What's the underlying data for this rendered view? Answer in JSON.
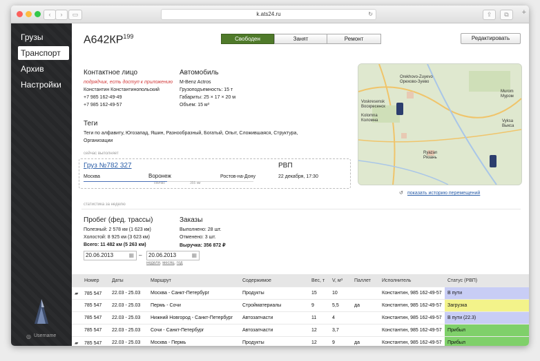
{
  "browser": {
    "url": "k.ats24.ru"
  },
  "sidebar": {
    "items": [
      {
        "label": "Грузы"
      },
      {
        "label": "Транспорт"
      },
      {
        "label": "Архив"
      },
      {
        "label": "Настройки"
      }
    ],
    "username": "Username"
  },
  "header": {
    "plate": "А642КР",
    "region": "199",
    "status_segments": [
      "Свободен",
      "Занят",
      "Ремонт"
    ],
    "edit_label": "Редактировать"
  },
  "contact": {
    "title": "Контактное лицо",
    "note": "подрядчик, есть доступ к приложению",
    "name": "Константин Константинопольский",
    "phone1": "+7 985 162-49-49",
    "phone2": "+7 985 162-49-57"
  },
  "vehicle": {
    "title": "Автомобиль",
    "model": "M-Benz Actros",
    "capacity": "Грузоподъемность: 15 т",
    "dimensions": "Габариты: 25 × 17 × 20 м",
    "volume": "Объем: 15 м³"
  },
  "tags": {
    "title": "Теги",
    "line1": "Теги по алфавиту, Югозапад, Яшин, Разнообразный, Богатый, Опыт, Сложившаяся, Структура,",
    "line2": "Организации"
  },
  "current": {
    "caption": "сейчас выполняет",
    "cargo_link": "Груз №782 327",
    "from": "Москва",
    "now": "Воронеж",
    "to": "Ростов-на-Дону",
    "now_label": "сейчас",
    "distance": "355 км",
    "eta_title": "РВП",
    "eta": "22 декабря, 17:30"
  },
  "map": {
    "labels": [
      "Orekhovo-Zuyevo",
      "Орехово-Зуево",
      "Voskresensk",
      "Воскресенск",
      "Kolomna",
      "Коломна",
      "Murom",
      "Муром",
      "Vyksa",
      "Выкса",
      "Ryazan",
      "Рязань"
    ],
    "history_link": "показать историю перемещений"
  },
  "stats": {
    "caption": "статистика за неделю",
    "mileage_title": "Пробег (фед. трассы)",
    "useful": "Полезный: 2 578 км (1 623 км)",
    "idle": "Холостой: 8 925 км (3 623 км)",
    "total": "Всего: 11 482 км (5 263 км)",
    "orders_title": "Заказы",
    "done": "Выполнено: 28 шт.",
    "canceled": "Отменено: 3 шт.",
    "revenue": "Выручка: 356 872 ₽"
  },
  "period": {
    "from": "20.06.2013",
    "to": "20.06.2013",
    "dash": "–",
    "presets": [
      "неделя",
      "месяц",
      "год"
    ]
  },
  "table": {
    "headers": [
      "Номер",
      "Даты",
      "Маршрут",
      "Содержимое",
      "Вес, т",
      "V, м³",
      "Паллет",
      "Исполнитель",
      "Статус (РВП)"
    ],
    "rows": [
      [
        "785 547",
        "22.03 - 25.03",
        "Москва - Санкт-Петербург",
        "Продукты",
        "15",
        "10",
        "",
        "Константин, 985 162-49-57",
        "В пути"
      ],
      [
        "785 547",
        "22.03 - 25.03",
        "Пермь - Сочи",
        "Стройматериалы",
        "9",
        "5,5",
        "да",
        "Константин, 985 162-49-57",
        "Загрузка"
      ],
      [
        "785 547",
        "22.03 - 25.03",
        "Нижний Новгород - Санкт-Петербург",
        "Автозапчасти",
        "11",
        "4",
        "",
        "Константин, 985 162-49-57",
        "В пути (22.3)"
      ],
      [
        "785 547",
        "22.03 - 25.03",
        "Сочи - Санкт-Петербург",
        "Автозапчасти",
        "12",
        "3,7",
        "",
        "Константин, 985 162-49-57",
        "Прибыл"
      ],
      [
        "785 547",
        "22.03 - 25.03",
        "Москва - Пермь",
        "Продукты",
        "12",
        "9",
        "да",
        "Константин, 985 162-49-57",
        "Прибыл"
      ]
    ],
    "status_colors": [
      "#c8cdf5",
      "#f3f38a",
      "#c8cdf5",
      "#7fd06a",
      "#7fd06a"
    ],
    "comment_rows": [
      true,
      false,
      false,
      false,
      true
    ]
  },
  "colors": {
    "accent": "#4f7a2a",
    "sidebar": "#262729"
  }
}
